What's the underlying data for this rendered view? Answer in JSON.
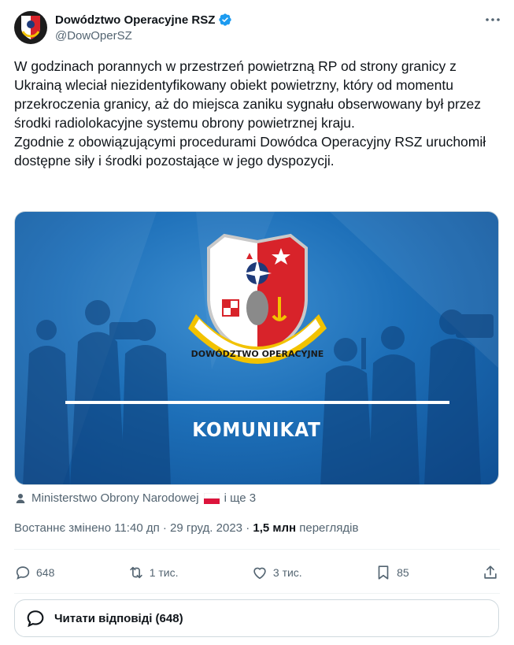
{
  "author": {
    "name": "Dowództwo Operacyjne RSZ",
    "handle": "@DowOperSZ"
  },
  "tweet": {
    "paragraphs": [
      "W godzinach porannych w przestrzeń powietrzną RP od strony granicy z Ukrainą wleciał niezidentyfikowany obiekt powietrzny, który od momentu przekroczenia granicy, aż do miejsca zaniku sygnału obserwowany był przez środki radiolokacyjne systemu obrony powietrznej kraju.",
      "Zgodnie z obowiązującymi procedurami Dowódca Operacyjny RSZ uruchomił dostępne siły i środki pozostające w jego dyspozycji."
    ]
  },
  "media": {
    "emblem_text": "DOWÓDZTWO OPERACYJNE",
    "caption": "KOMUNIKAT"
  },
  "tagged": {
    "name": "Ministerstwo Obrony Narodowej",
    "more": "і ще 3"
  },
  "meta": {
    "edited_label": "Востаннє змінено",
    "time": "11:40 дп",
    "date": "29 груд. 2023",
    "views_count": "1,5 млн",
    "views_label": "переглядів"
  },
  "actions": {
    "replies": "648",
    "reposts": "1 тис.",
    "likes": "3 тис.",
    "bookmarks": "85"
  },
  "read_replies": "Читати відповіді (648)",
  "colors": {
    "verified": "#1d9bf0",
    "text": "#0f1419",
    "secondary": "#536471",
    "media_blue": "#1d6fb8"
  }
}
